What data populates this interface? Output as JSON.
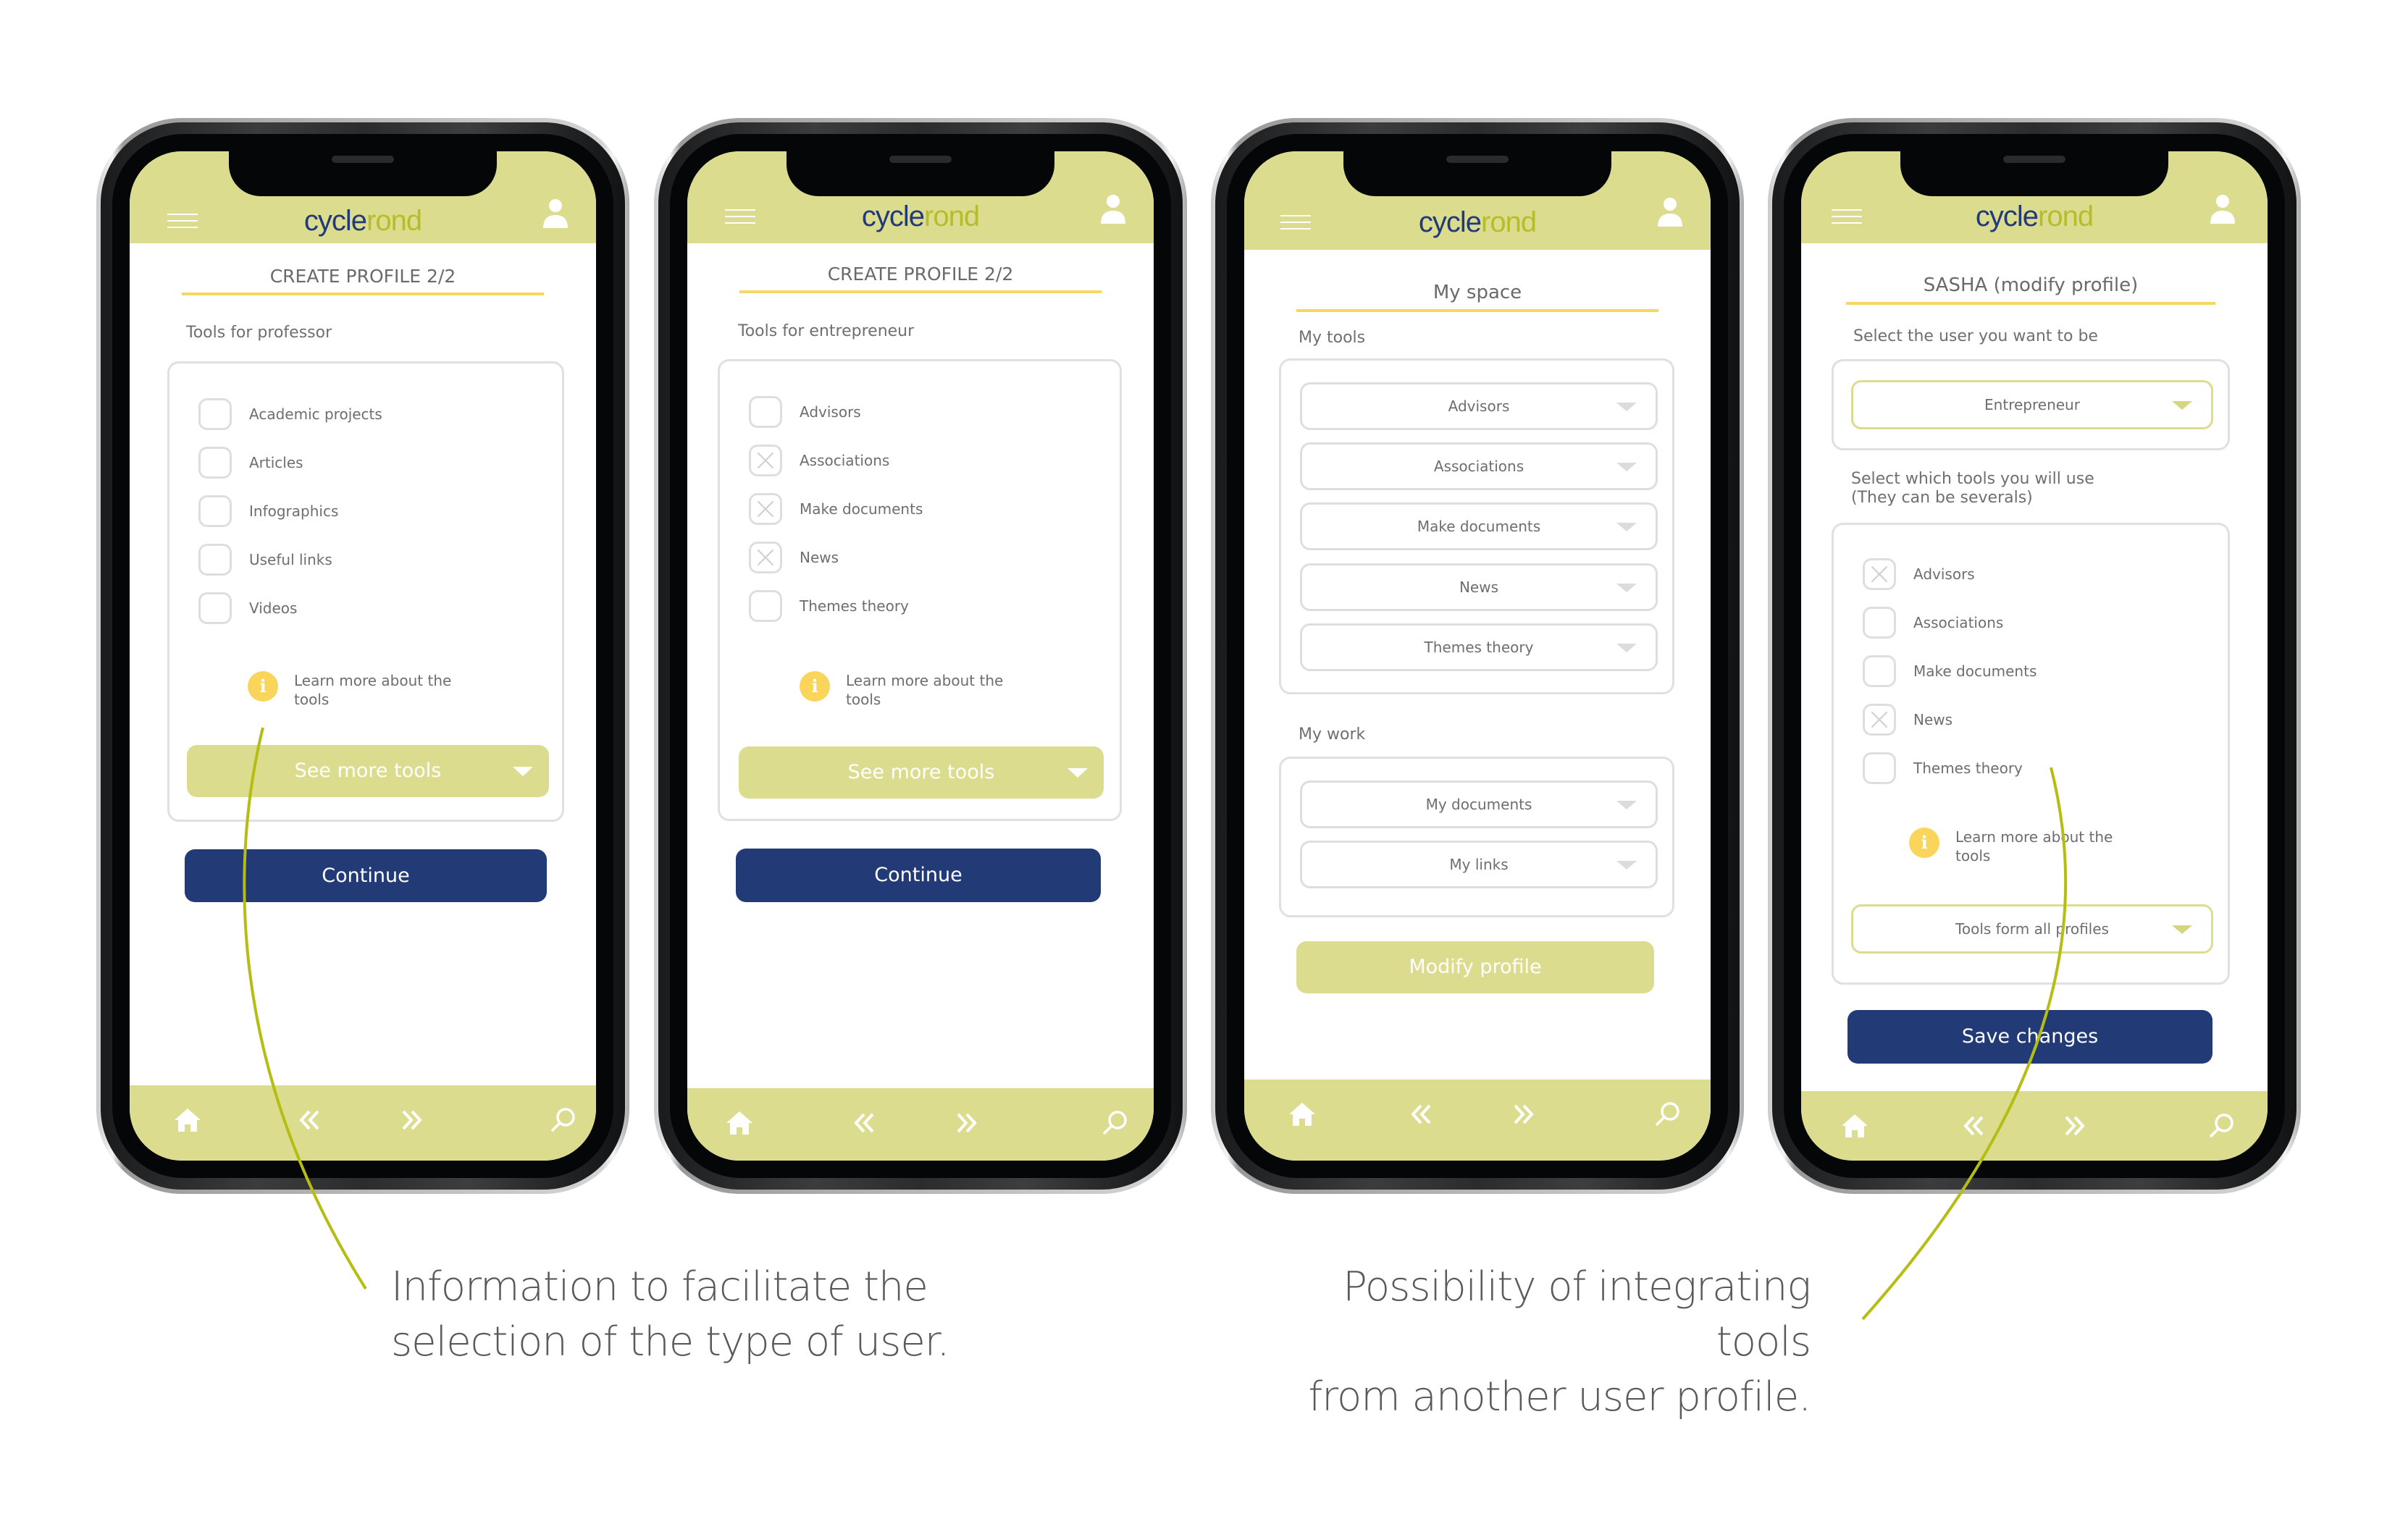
{
  "brand": {
    "logo_part1": "cycle",
    "logo_part2": "rond",
    "colors": {
      "navy": "#223a75",
      "olive": "#dcdc8e",
      "lime_accent": "#b6bd2b",
      "yellow_info": "#fad55c",
      "underline": "#f7d764"
    }
  },
  "screens": [
    {
      "title": "CREATE PROFILE 2/2",
      "section_label": "Tools for professor",
      "tools": [
        {
          "label": "Academic projects",
          "checked": false
        },
        {
          "label": "Articles",
          "checked": false
        },
        {
          "label": "Infographics",
          "checked": false
        },
        {
          "label": "Useful links",
          "checked": false
        },
        {
          "label": "Videos",
          "checked": false
        }
      ],
      "info_icon": "i",
      "info_text": "Learn more about the tools",
      "see_more_label": "See more tools",
      "continue_label": "Continue"
    },
    {
      "title": "CREATE PROFILE 2/2",
      "section_label": "Tools for entrepreneur",
      "tools": [
        {
          "label": "Advisors",
          "checked": false
        },
        {
          "label": "Associations",
          "checked": true
        },
        {
          "label": "Make documents",
          "checked": true
        },
        {
          "label": "News",
          "checked": true
        },
        {
          "label": "Themes theory",
          "checked": false
        }
      ],
      "info_icon": "i",
      "info_text": "Learn more about the tools",
      "see_more_label": "See more tools",
      "continue_label": "Continue"
    },
    {
      "title": "My space",
      "tools_label": "My tools",
      "tools": [
        "Advisors",
        "Associations",
        "Make documents",
        "News",
        "Themes theory"
      ],
      "work_label": "My work",
      "work": [
        "My documents",
        "My links"
      ],
      "modify_label": "Modify profile"
    },
    {
      "title": "SASHA (modify profile)",
      "user_label": "Select the user you want to be",
      "user_value": "Entrepreneur",
      "tools_label_line1": "Select which tools you will use",
      "tools_label_line2": "(They can be severals)",
      "tools": [
        {
          "label": "Advisors",
          "checked": true
        },
        {
          "label": "Associations",
          "checked": false
        },
        {
          "label": "Make documents",
          "checked": false
        },
        {
          "label": "News",
          "checked": true
        },
        {
          "label": "Themes theory",
          "checked": false
        }
      ],
      "info_icon": "i",
      "info_text": "Learn more about the tools",
      "all_profiles_label": "Tools form all profiles",
      "save_label": "Save changes"
    }
  ],
  "nav_icons": [
    "home-icon",
    "double-chevron-left-icon",
    "double-chevron-right-icon",
    "search-icon"
  ],
  "captions": {
    "left_line1": "Information to facilitate the",
    "left_line2": "selection of the type of user.",
    "right_line1": "Possibility of integrating tools",
    "right_line2": "from another user profile."
  }
}
